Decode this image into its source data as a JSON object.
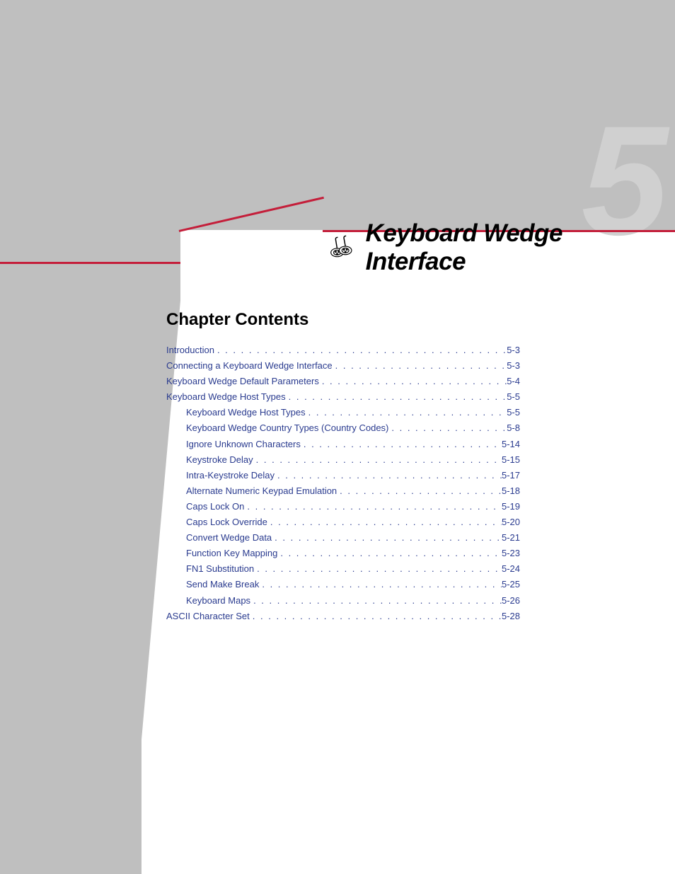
{
  "chapter_number": "5",
  "chapter_title": "Keyboard Wedge Interface",
  "section_heading": "Chapter Contents",
  "toc": [
    {
      "label": "Introduction",
      "page": "5-3",
      "indent": false
    },
    {
      "label": "Connecting a Keyboard Wedge Interface",
      "page": "5-3",
      "indent": false
    },
    {
      "label": "Keyboard Wedge Default Parameters",
      "page": "5-4",
      "indent": false
    },
    {
      "label": "Keyboard Wedge Host Types",
      "page": "5-5",
      "indent": false
    },
    {
      "label": "Keyboard Wedge Host Types",
      "page": "5-5",
      "indent": true
    },
    {
      "label": "Keyboard Wedge Country Types (Country Codes)",
      "page": "5-8",
      "indent": true
    },
    {
      "label": "Ignore Unknown Characters",
      "page": "5-14",
      "indent": true
    },
    {
      "label": "Keystroke Delay",
      "page": "5-15",
      "indent": true
    },
    {
      "label": "Intra-Keystroke Delay",
      "page": "5-17",
      "indent": true
    },
    {
      "label": "Alternate Numeric Keypad Emulation",
      "page": "5-18",
      "indent": true
    },
    {
      "label": "Caps Lock On",
      "page": "5-19",
      "indent": true
    },
    {
      "label": "Caps Lock Override",
      "page": "5-20",
      "indent": true
    },
    {
      "label": "Convert Wedge Data",
      "page": "5-21",
      "indent": true
    },
    {
      "label": "Function Key Mapping",
      "page": "5-23",
      "indent": true
    },
    {
      "label": "FN1 Substitution",
      "page": "5-24",
      "indent": true
    },
    {
      "label": "Send Make Break",
      "page": "5-25",
      "indent": true
    },
    {
      "label": "Keyboard Maps",
      "page": "5-26",
      "indent": true
    },
    {
      "label": "ASCII Character Set",
      "page": "5-28",
      "indent": false
    }
  ]
}
